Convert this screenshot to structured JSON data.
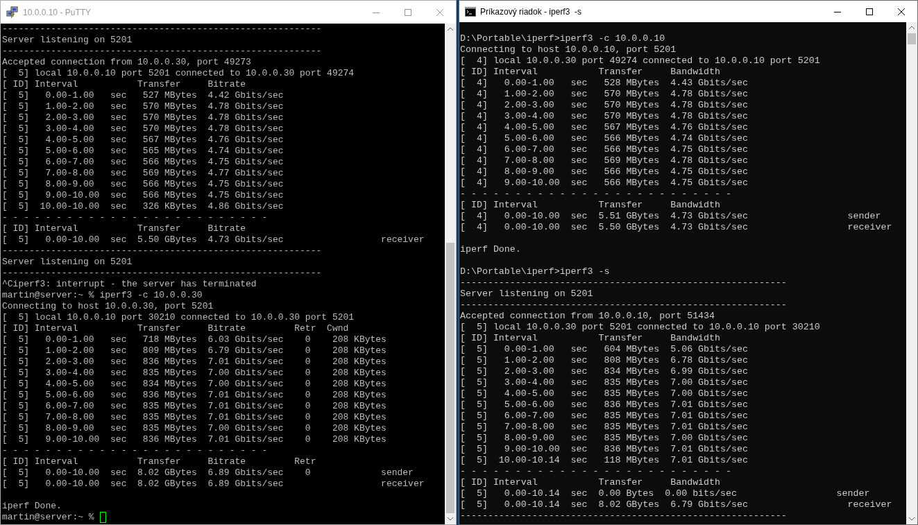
{
  "windows": [
    {
      "kind": "putty",
      "title": "10.0.0.10 - PuTTY",
      "active": false,
      "cursor_visible": true,
      "lines": [
        {
          "kind": "text",
          "text": "-----------------------------------------------------------"
        },
        {
          "kind": "text",
          "text": "Server listening on 5201"
        },
        {
          "kind": "text",
          "text": "-----------------------------------------------------------"
        },
        {
          "kind": "text",
          "text": "Accepted connection from 10.0.0.30, port 49273"
        },
        {
          "kind": "text",
          "text": "[  5] local 10.0.0.10 port 5201 connected to 10.0.0.30 port 49274"
        },
        {
          "kind": "text",
          "text": "[ ID] Interval           Transfer     Bitrate"
        },
        {
          "kind": "text",
          "text": "[  5]   0.00-1.00   sec   527 MBytes  4.42 Gbits/sec"
        },
        {
          "kind": "text",
          "text": "[  5]   1.00-2.00   sec   570 MBytes  4.78 Gbits/sec"
        },
        {
          "kind": "text",
          "text": "[  5]   2.00-3.00   sec   570 MBytes  4.78 Gbits/sec"
        },
        {
          "kind": "text",
          "text": "[  5]   3.00-4.00   sec   570 MBytes  4.78 Gbits/sec"
        },
        {
          "kind": "text",
          "text": "[  5]   4.00-5.00   sec   567 MBytes  4.76 Gbits/sec"
        },
        {
          "kind": "text",
          "text": "[  5]   5.00-6.00   sec   565 MBytes  4.74 Gbits/sec"
        },
        {
          "kind": "text",
          "text": "[  5]   6.00-7.00   sec   566 MBytes  4.75 Gbits/sec"
        },
        {
          "kind": "text",
          "text": "[  5]   7.00-8.00   sec   569 MBytes  4.77 Gbits/sec"
        },
        {
          "kind": "text",
          "text": "[  5]   8.00-9.00   sec   566 MBytes  4.75 Gbits/sec"
        },
        {
          "kind": "text",
          "text": "[  5]   9.00-10.00  sec   566 MBytes  4.75 Gbits/sec"
        },
        {
          "kind": "text",
          "text": "[  5]  10.00-10.00  sec   326 KBytes  4.86 Gbits/sec"
        },
        {
          "kind": "text",
          "text": "- - - - - - - - - - - - - - - - - - - - - - - - -"
        },
        {
          "kind": "text",
          "text": "[ ID] Interval           Transfer     Bitrate"
        },
        {
          "kind": "text",
          "text": "[  5]   0.00-10.00  sec  5.50 GBytes  4.73 Gbits/sec                  receiver"
        },
        {
          "kind": "text",
          "text": "-----------------------------------------------------------"
        },
        {
          "kind": "text",
          "text": "Server listening on 5201"
        },
        {
          "kind": "text",
          "text": "-----------------------------------------------------------"
        },
        {
          "kind": "text",
          "text": "^Ciperf3: interrupt - the server has terminated"
        },
        {
          "kind": "text",
          "text": "martin@server:~ % iperf3 -c 10.0.0.30"
        },
        {
          "kind": "text",
          "text": "Connecting to host 10.0.0.30, port 5201"
        },
        {
          "kind": "text",
          "text": "[  5] local 10.0.0.10 port 30210 connected to 10.0.0.30 port 5201"
        },
        {
          "kind": "text",
          "text": "[ ID] Interval           Transfer     Bitrate         Retr  Cwnd"
        },
        {
          "kind": "text",
          "text": "[  5]   0.00-1.00   sec   718 MBytes  6.03 Gbits/sec    0    208 KBytes"
        },
        {
          "kind": "text",
          "text": "[  5]   1.00-2.00   sec   809 MBytes  6.79 Gbits/sec    0    208 KBytes"
        },
        {
          "kind": "text",
          "text": "[  5]   2.00-3.00   sec   836 MBytes  7.01 Gbits/sec    0    208 KBytes"
        },
        {
          "kind": "text",
          "text": "[  5]   3.00-4.00   sec   835 MBytes  7.00 Gbits/sec    0    208 KBytes"
        },
        {
          "kind": "text",
          "text": "[  5]   4.00-5.00   sec   834 MBytes  7.00 Gbits/sec    0    208 KBytes"
        },
        {
          "kind": "text",
          "text": "[  5]   5.00-6.00   sec   836 MBytes  7.01 Gbits/sec    0    208 KBytes"
        },
        {
          "kind": "text",
          "text": "[  5]   6.00-7.00   sec   835 MBytes  7.01 Gbits/sec    0    208 KBytes"
        },
        {
          "kind": "text",
          "text": "[  5]   7.00-8.00   sec   835 MBytes  7.01 Gbits/sec    0    208 KBytes"
        },
        {
          "kind": "text",
          "text": "[  5]   8.00-9.00   sec   835 MBytes  7.00 Gbits/sec    0    208 KBytes"
        },
        {
          "kind": "text",
          "text": "[  5]   9.00-10.00  sec   836 MBytes  7.01 Gbits/sec    0    208 KBytes"
        },
        {
          "kind": "text",
          "text": "- - - - - - - - - - - - - - - - - - - - - - - - -"
        },
        {
          "kind": "text",
          "text": "[ ID] Interval           Transfer     Bitrate         Retr"
        },
        {
          "kind": "text",
          "text": "[  5]   0.00-10.00  sec  8.02 GBytes  6.89 Gbits/sec    0             sender"
        },
        {
          "kind": "text",
          "text": "[  5]   0.00-10.00  sec  8.02 GBytes  6.89 Gbits/sec                  receiver"
        },
        {
          "kind": "blank"
        },
        {
          "kind": "text",
          "text": "iperf Done."
        },
        {
          "kind": "text",
          "text": "martin@server:~ %"
        }
      ]
    },
    {
      "kind": "cmd",
      "title": "Príkazový riadok - iperf3  -s",
      "active": true,
      "cursor_visible": false,
      "lines": [
        {
          "kind": "blank"
        },
        {
          "kind": "text",
          "text": "D:\\Portable\\iperf>iperf3 -c 10.0.0.10"
        },
        {
          "kind": "text",
          "text": "Connecting to host 10.0.0.10, port 5201"
        },
        {
          "kind": "text",
          "text": "[  4] local 10.0.0.30 port 49274 connected to 10.0.0.10 port 5201"
        },
        {
          "kind": "text",
          "text": "[ ID] Interval           Transfer     Bandwidth"
        },
        {
          "kind": "text",
          "text": "[  4]   0.00-1.00   sec   528 MBytes  4.43 Gbits/sec"
        },
        {
          "kind": "text",
          "text": "[  4]   1.00-2.00   sec   570 MBytes  4.78 Gbits/sec"
        },
        {
          "kind": "text",
          "text": "[  4]   2.00-3.00   sec   570 MBytes  4.78 Gbits/sec"
        },
        {
          "kind": "text",
          "text": "[  4]   3.00-4.00   sec   570 MBytes  4.78 Gbits/sec"
        },
        {
          "kind": "text",
          "text": "[  4]   4.00-5.00   sec   567 MBytes  4.76 Gbits/sec"
        },
        {
          "kind": "text",
          "text": "[  4]   5.00-6.00   sec   566 MBytes  4.74 Gbits/sec"
        },
        {
          "kind": "text",
          "text": "[  4]   6.00-7.00   sec   566 MBytes  4.75 Gbits/sec"
        },
        {
          "kind": "text",
          "text": "[  4]   7.00-8.00   sec   569 MBytes  4.78 Gbits/sec"
        },
        {
          "kind": "text",
          "text": "[  4]   8.00-9.00   sec   566 MBytes  4.75 Gbits/sec"
        },
        {
          "kind": "text",
          "text": "[  4]   9.00-10.00  sec   566 MBytes  4.75 Gbits/sec"
        },
        {
          "kind": "text",
          "text": "- - - - - - - - - - - - - - - - - - - - - - - - -"
        },
        {
          "kind": "text",
          "text": "[ ID] Interval           Transfer     Bandwidth"
        },
        {
          "kind": "text",
          "text": "[  4]   0.00-10.00  sec  5.51 GBytes  4.73 Gbits/sec                  sender"
        },
        {
          "kind": "text",
          "text": "[  4]   0.00-10.00  sec  5.50 GBytes  4.73 Gbits/sec                  receiver"
        },
        {
          "kind": "blank"
        },
        {
          "kind": "text",
          "text": "iperf Done."
        },
        {
          "kind": "blank"
        },
        {
          "kind": "text",
          "text": "D:\\Portable\\iperf>iperf3 -s"
        },
        {
          "kind": "text",
          "text": "-----------------------------------------------------------"
        },
        {
          "kind": "text",
          "text": "Server listening on 5201"
        },
        {
          "kind": "text",
          "text": "-----------------------------------------------------------"
        },
        {
          "kind": "text",
          "text": "Accepted connection from 10.0.0.10, port 51434"
        },
        {
          "kind": "text",
          "text": "[  5] local 10.0.0.30 port 5201 connected to 10.0.0.10 port 30210"
        },
        {
          "kind": "text",
          "text": "[ ID] Interval           Transfer     Bandwidth"
        },
        {
          "kind": "text",
          "text": "[  5]   0.00-1.00   sec   604 MBytes  5.06 Gbits/sec"
        },
        {
          "kind": "text",
          "text": "[  5]   1.00-2.00   sec   808 MBytes  6.78 Gbits/sec"
        },
        {
          "kind": "text",
          "text": "[  5]   2.00-3.00   sec   834 MBytes  6.99 Gbits/sec"
        },
        {
          "kind": "text",
          "text": "[  5]   3.00-4.00   sec   835 MBytes  7.00 Gbits/sec"
        },
        {
          "kind": "text",
          "text": "[  5]   4.00-5.00   sec   835 MBytes  7.00 Gbits/sec"
        },
        {
          "kind": "text",
          "text": "[  5]   5.00-6.00   sec   836 MBytes  7.01 Gbits/sec"
        },
        {
          "kind": "text",
          "text": "[  5]   6.00-7.00   sec   835 MBytes  7.01 Gbits/sec"
        },
        {
          "kind": "text",
          "text": "[  5]   7.00-8.00   sec   835 MBytes  7.01 Gbits/sec"
        },
        {
          "kind": "text",
          "text": "[  5]   8.00-9.00   sec   835 MBytes  7.00 Gbits/sec"
        },
        {
          "kind": "text",
          "text": "[  5]   9.00-10.00  sec   836 MBytes  7.01 Gbits/sec"
        },
        {
          "kind": "text",
          "text": "[  5]  10.00-10.14  sec   118 MBytes  7.01 Gbits/sec"
        },
        {
          "kind": "text",
          "text": "- - - - - - - - - - - - - - - - - - - - - - - - -"
        },
        {
          "kind": "text",
          "text": "[ ID] Interval           Transfer     Bandwidth"
        },
        {
          "kind": "text",
          "text": "[  5]   0.00-10.14  sec  0.00 Bytes  0.00 bits/sec                  sender"
        },
        {
          "kind": "text",
          "text": "[  5]   0.00-10.14  sec  8.02 GBytes  6.79 Gbits/sec                  receiver"
        },
        {
          "kind": "text",
          "text": "-----------------------------------------------------------"
        }
      ]
    }
  ]
}
